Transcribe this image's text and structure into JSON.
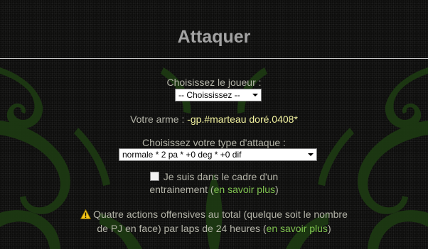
{
  "page_title": "Attaquer",
  "player": {
    "label": "Choisissez le joueur :",
    "select_value": "-- Choississez --"
  },
  "weapon": {
    "label": "Votre arme :",
    "value": "-gp.#marteau doré.0408*"
  },
  "attack_type": {
    "label": "Choisissez votre type d'attaque :",
    "select_value": "normale * 2 pa * +0 deg * +0 dif"
  },
  "training": {
    "text_line1": "Je suis dans le cadre d'un",
    "text_line2_prefix": "entrainement (",
    "link": "en savoir plus",
    "text_suffix": ")"
  },
  "warning": {
    "icon": "warning-icon",
    "line1": "Quatre actions offensives au total (quelque soit le nombre",
    "line2_prefix": "de PJ en face) par laps de 24 heures (",
    "link": "en savoir plus",
    "suffix": ")"
  },
  "colors": {
    "background": "#0d0d0c",
    "ornament": "#1d3b12",
    "text": "#b4b4a8",
    "weapon": "#f2f2a0",
    "link": "#7fc24f",
    "warning": "#f5c518"
  }
}
